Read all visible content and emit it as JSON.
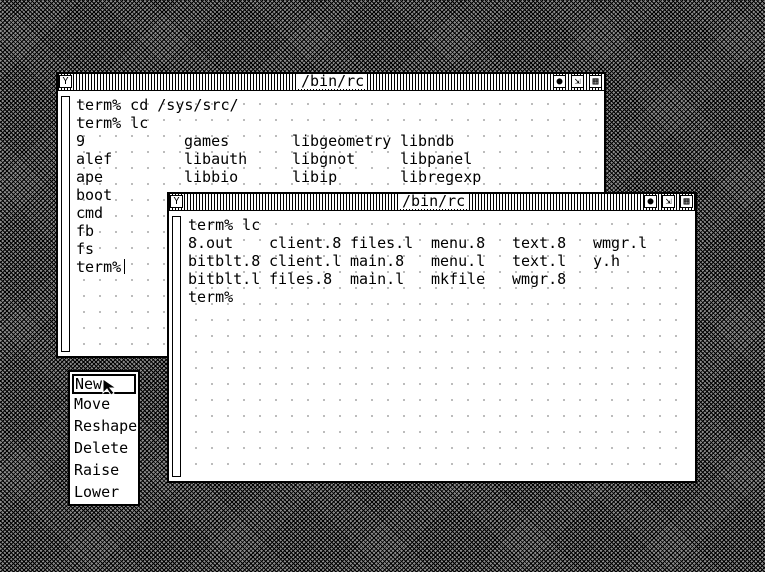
{
  "back_window": {
    "title": "/bin/rc",
    "tag_icon": "Y",
    "lines": [
      [
        "term% cd /sys/src/"
      ],
      [
        "term% lc"
      ],
      [
        "9",
        "games",
        "libgeometry",
        "libndb"
      ],
      [
        "alef",
        "libauth",
        "libgnot",
        "libpanel"
      ],
      [
        "ape",
        "libbio",
        "libip",
        "libregexp"
      ],
      [
        "boot"
      ],
      [
        "cmd"
      ],
      [
        "fb"
      ],
      [
        "fs"
      ],
      [
        "term%"
      ]
    ]
  },
  "front_window": {
    "title": "/bin/rc",
    "tag_icon": "Y",
    "lines": [
      [
        "term% lc"
      ],
      [
        "8.out",
        "client.8",
        "files.l",
        "menu.8",
        "text.8",
        "wmgr.l"
      ],
      [
        "bitblt.8",
        "client.l",
        "main.8",
        "menu.l",
        "text.l",
        "y.h"
      ],
      [
        "bitblt.l",
        "files.8",
        "main.l",
        "mkfile",
        "wmgr.8"
      ],
      [
        "term%"
      ]
    ]
  },
  "menu": {
    "items": [
      "New",
      "Move",
      "Reshape",
      "Delete",
      "Raise",
      "Lower"
    ],
    "selected": "New"
  }
}
